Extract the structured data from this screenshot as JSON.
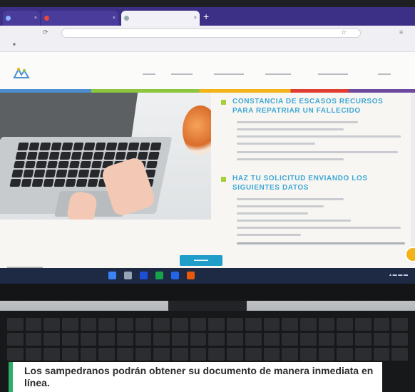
{
  "caption": {
    "text": "Los sampedranos podrán obtener su documento de manera inmediata en línea.",
    "accent_color": "#2fae6a"
  },
  "screen": {
    "sections": [
      {
        "title_line1": "CONSTANCIA DE ESCASOS RECURSOS",
        "title_line2": "PARA REPATRIAR UN FALLECIDO"
      },
      {
        "title_line1": "HAZ TU SOLICITUD ENVIANDO LOS",
        "title_line2": "SIGUIENTES DATOS"
      }
    ],
    "brand_colors": [
      "#4c8ed0",
      "#8cc63f",
      "#f2b418",
      "#e03c31",
      "#6b4aa0"
    ],
    "title_color": "#3fa7d6"
  }
}
